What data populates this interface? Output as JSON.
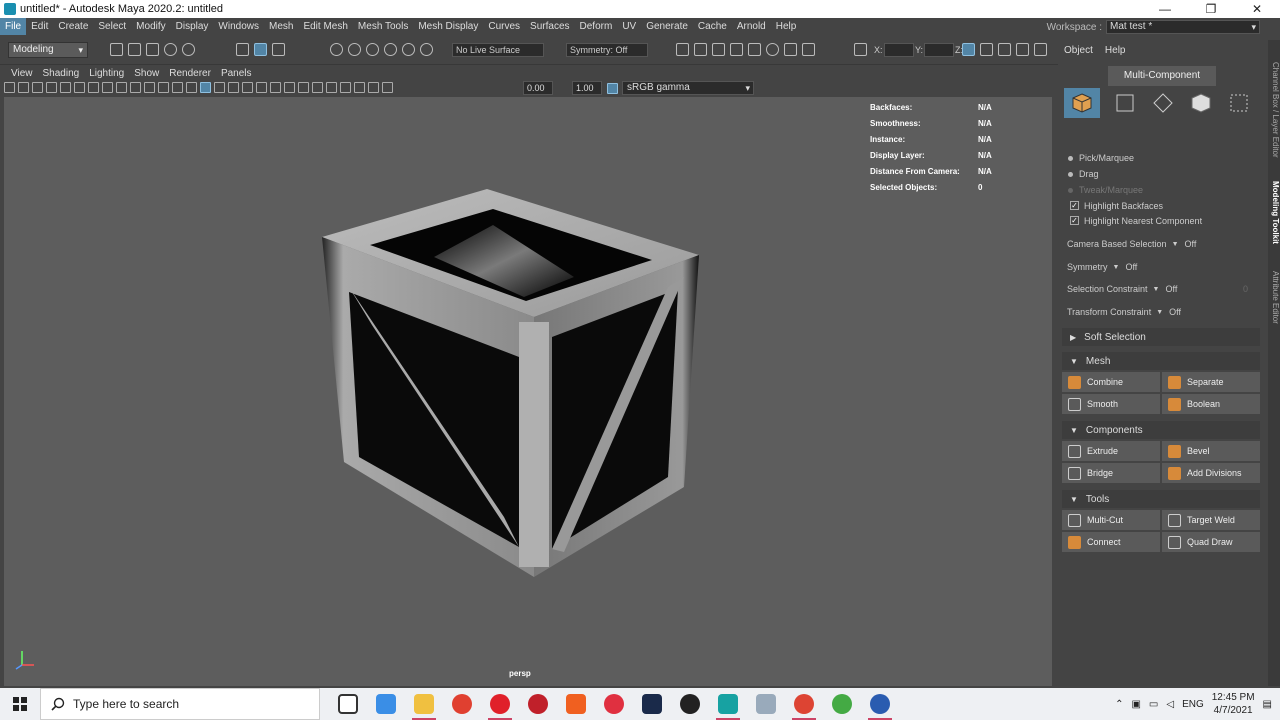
{
  "window": {
    "title": "untitled* - Autodesk Maya 2020.2: untitled",
    "minimize": "—",
    "maximize": "❐",
    "close": "✕"
  },
  "menubar": {
    "items": [
      "File",
      "Edit",
      "Create",
      "Select",
      "Modify",
      "Display",
      "Windows",
      "Mesh",
      "Edit Mesh",
      "Mesh Tools",
      "Mesh Display",
      "Curves",
      "Surfaces",
      "Deform",
      "UV",
      "Generate",
      "Cache",
      "Arnold",
      "Help"
    ],
    "workspace_label": "Workspace :",
    "workspace_value": "Mat test *"
  },
  "toolbar": {
    "mode": "Modeling",
    "live_surface": "No Live Surface",
    "symmetry": "Symmetry: Off",
    "x_label": "X:",
    "y_label": "Y:",
    "z_label": "Z:"
  },
  "right_menu": {
    "object": "Object",
    "help": "Help"
  },
  "panel_menu": [
    "View",
    "Shading",
    "Lighting",
    "Show",
    "Renderer",
    "Panels"
  ],
  "panel_toolbar": {
    "exposure": "0.00",
    "gamma_value": "1.00",
    "color_space": "sRGB gamma"
  },
  "hud": [
    {
      "label": "Backfaces:",
      "value": "N/A"
    },
    {
      "label": "Smoothness:",
      "value": "N/A"
    },
    {
      "label": "Instance:",
      "value": "N/A"
    },
    {
      "label": "Display Layer:",
      "value": "N/A"
    },
    {
      "label": "Distance From Camera:",
      "value": "N/A"
    },
    {
      "label": "Selected Objects:",
      "value": "0"
    }
  ],
  "viewport": {
    "camera": "persp"
  },
  "toolkit": {
    "tab": "Multi-Component",
    "pick_options": [
      {
        "label": "Pick/Marquee",
        "enabled": true
      },
      {
        "label": "Drag",
        "enabled": true
      },
      {
        "label": "Tweak/Marquee",
        "enabled": false
      }
    ],
    "checks": [
      "Highlight Backfaces",
      "Highlight Nearest Component"
    ],
    "options": [
      {
        "label": "Camera Based Selection",
        "value": "Off"
      },
      {
        "label": "Symmetry",
        "value": "Off"
      },
      {
        "label": "Selection Constraint",
        "value": "Off",
        "extra": "0"
      },
      {
        "label": "Transform Constraint",
        "value": "Off"
      }
    ],
    "soft_selection": "Soft Selection",
    "sections": {
      "mesh": {
        "title": "Mesh",
        "buttons": [
          "Combine",
          "Separate",
          "Smooth",
          "Boolean"
        ]
      },
      "components": {
        "title": "Components",
        "buttons": [
          "Extrude",
          "Bevel",
          "Bridge",
          "Add Divisions"
        ]
      },
      "tools": {
        "title": "Tools",
        "buttons": [
          "Multi-Cut",
          "Target Weld",
          "Connect",
          "Quad Draw"
        ]
      }
    }
  },
  "side_tabs": [
    "Channel Box / Layer Editor",
    "Modeling Toolkit",
    "Attribute Editor"
  ],
  "taskbar": {
    "search_placeholder": "Type here to search",
    "lang": "ENG",
    "time": "12:45 PM",
    "date": "4/7/2021"
  },
  "colors": {
    "accent": "#5285a6",
    "viewport_bg": "#5d5d5d",
    "panel_bg": "#444444",
    "button_orange": "#d78a3a"
  }
}
